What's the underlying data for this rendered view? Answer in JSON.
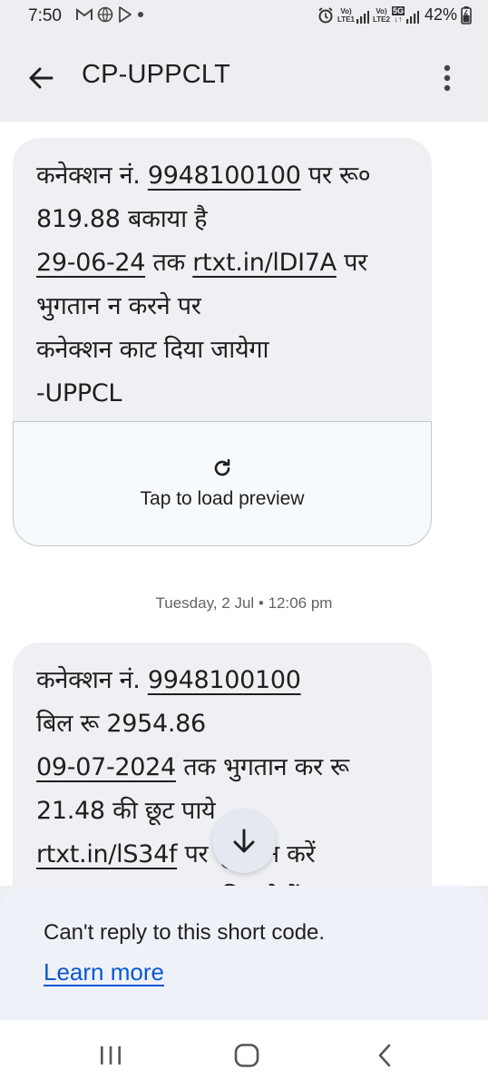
{
  "status_bar": {
    "time": "7:50",
    "battery": "42%",
    "sim1": "LTE1",
    "sim2": "LTE2",
    "network": "5G"
  },
  "app_bar": {
    "title": "CP-UPPCLT"
  },
  "messages": [
    {
      "lines": [
        [
          {
            "t": "कनेक्शन नं. "
          },
          {
            "t": "9948100100",
            "link": true
          },
          {
            "t": " पर रू०"
          }
        ],
        [
          {
            "t": "819.88 बकाया है"
          }
        ],
        [
          {
            "t": "29-06-24",
            "link": true
          },
          {
            "t": " तक "
          },
          {
            "t": "rtxt.in/lDI7A",
            "link": true
          },
          {
            "t": " पर"
          }
        ],
        [
          {
            "t": "भुगतान न करने पर"
          }
        ],
        [
          {
            "t": "कनेक्शन काट दिया जायेगा"
          }
        ],
        [
          {
            "t": "-UPPCL"
          }
        ]
      ]
    },
    {
      "lines": [
        [
          {
            "t": "कनेक्शन नं. "
          },
          {
            "t": "9948100100",
            "link": true
          }
        ],
        [
          {
            "t": "बिल रू 2954.86"
          }
        ],
        [
          {
            "t": "09-07-2024",
            "link": true
          },
          {
            "t": " तक भुगतान कर रू"
          }
        ],
        [
          {
            "t": "21.48 की छूट पाये"
          }
        ],
        [
          {
            "t": "rtxt.in/lS34f",
            "link": true
          },
          {
            "t": " पर भुगतान करें"
          }
        ],
        [
          {
            "t": "rtxt.in/lS345",
            "link": true
          },
          {
            "t": " पर बिल देखें"
          }
        ]
      ]
    }
  ],
  "preview": {
    "label": "Tap to load preview"
  },
  "timestamp": "Tuesday, 2 Jul • 12:06 pm",
  "reply_panel": {
    "text": "Can't reply to this short code.",
    "link": "Learn more"
  },
  "colors": {
    "link": "#0b57d0",
    "bubble": "#eef0f4",
    "background": "#eceef2"
  }
}
